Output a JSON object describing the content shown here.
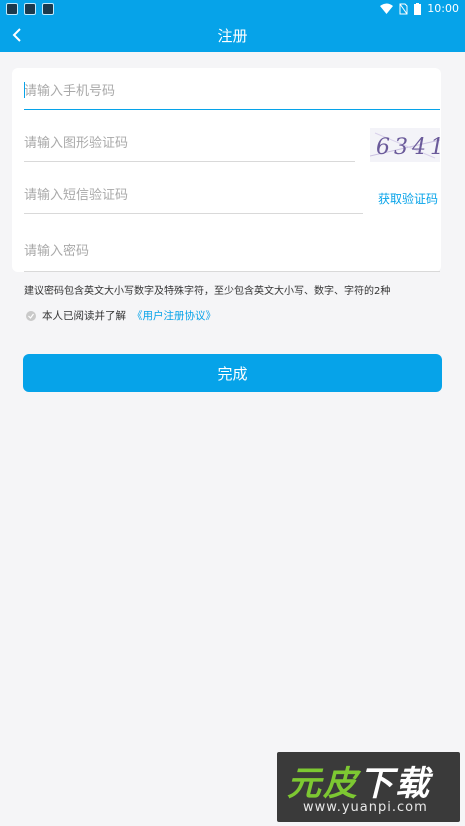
{
  "status_bar": {
    "time": "10:00"
  },
  "app_bar": {
    "title": "注册"
  },
  "form": {
    "phone_placeholder": "请输入手机号码",
    "image_code_placeholder": "请输入图形验证码",
    "captcha_text": "6341",
    "sms_code_placeholder": "请输入短信验证码",
    "get_code_label": "获取验证码",
    "password_placeholder": "请输入密码"
  },
  "password_hint": "建议密码包含英文大小写数字及特殊字符，至少包含英文大小写、数字、字符的2种",
  "agreement": {
    "text": "本人已阅读并了解",
    "link": "《用户注册协议》"
  },
  "done_button": "完成",
  "watermark": {
    "brand": "元皮下载",
    "brand_green": "元皮",
    "brand_white": "下载",
    "url": "www.yuanpi.com"
  },
  "colors": {
    "primary": "#06a3e9",
    "background": "#f5f5f7"
  }
}
